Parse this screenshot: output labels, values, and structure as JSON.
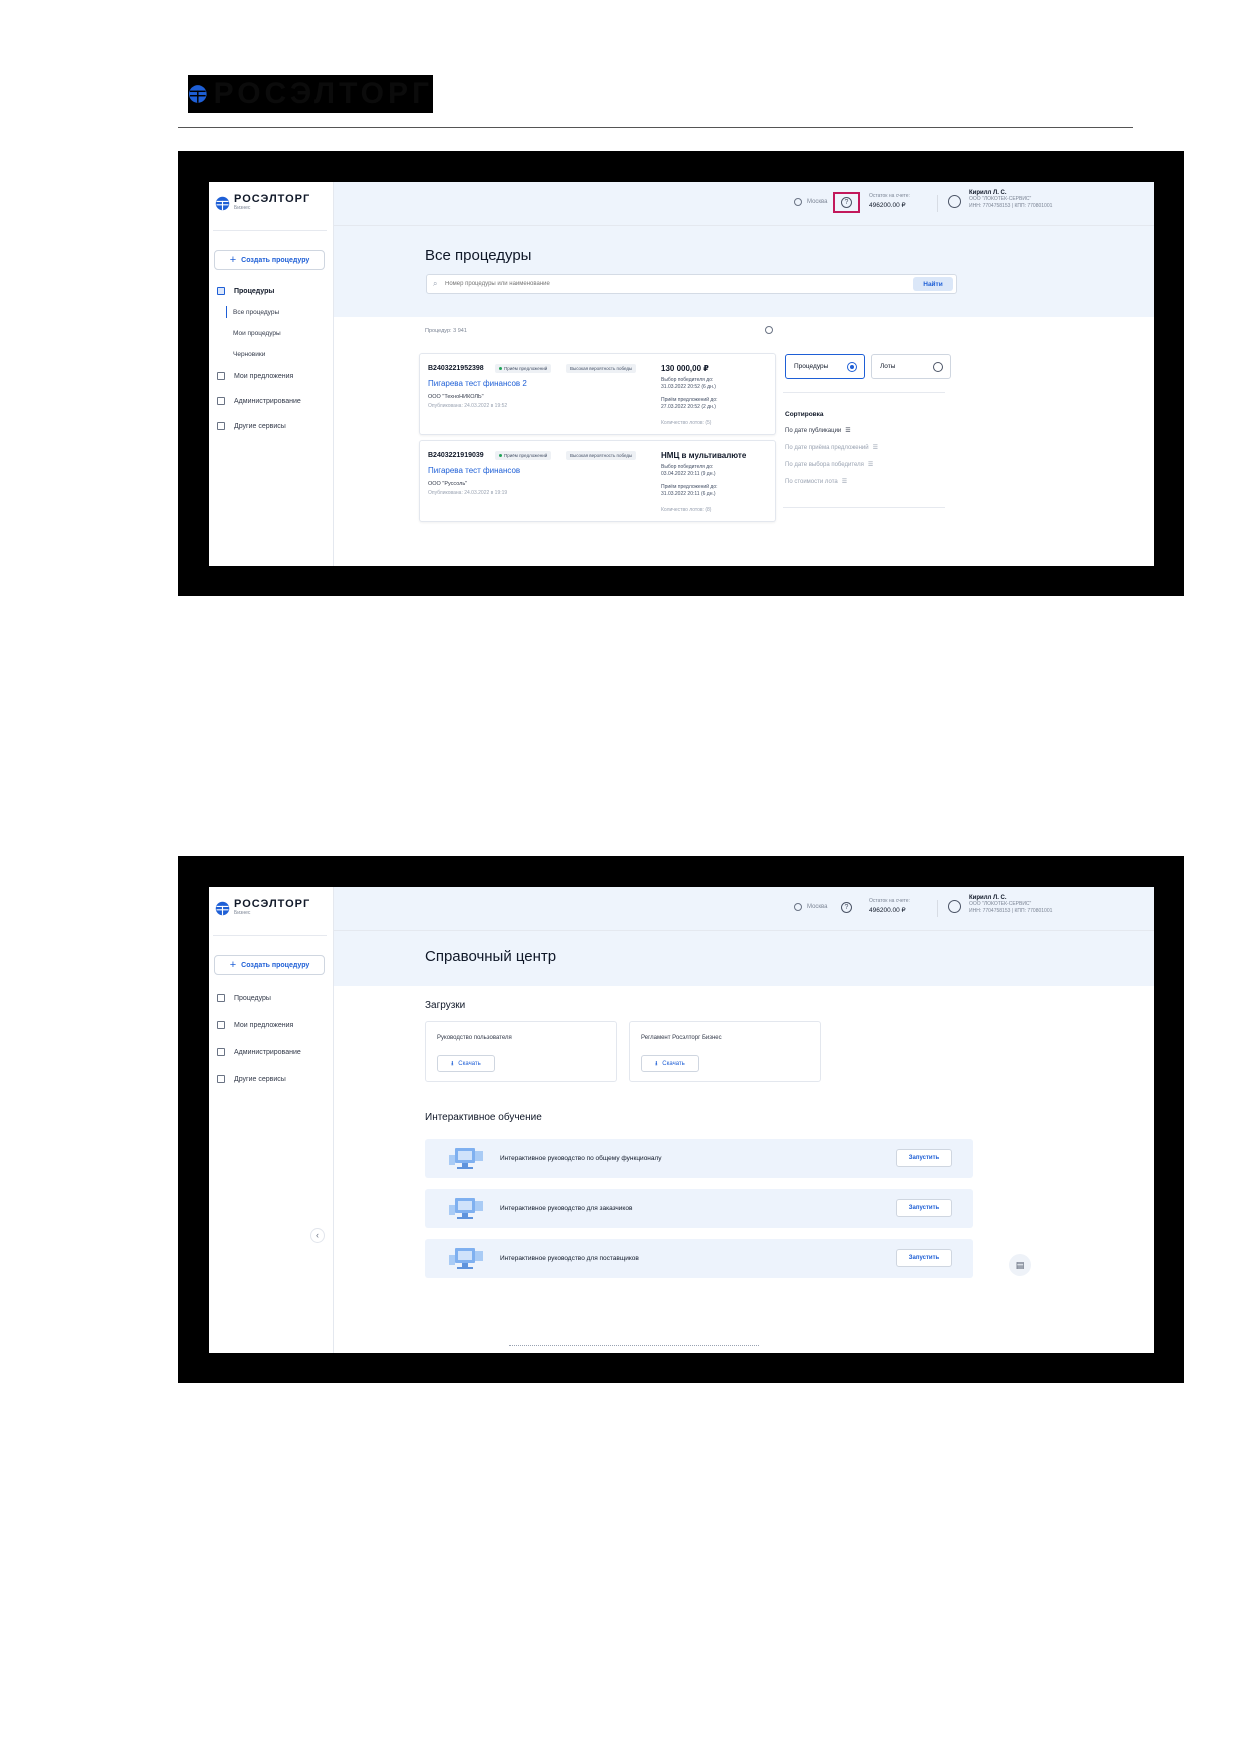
{
  "doc_header": {
    "logo_text": "РОСЭЛТОРГ"
  },
  "app": {
    "brand": "РОСЭЛТОРГ",
    "brand_sub": "Бизнес",
    "create_button": "Создать процедуру",
    "topbar": {
      "location": "Москва",
      "balance_label": "Остаток на счете:",
      "balance_value": "496200.00 ₽",
      "user_name": "Кирилл Л. С.",
      "user_org": "ООО \"ЛОКОТЕК-СЕРВИС\"",
      "user_inn": "ИНН: 7704758153 | КПП: 770801001"
    },
    "nav": {
      "procedures": "Процедуры",
      "all_procedures": "Все процедуры",
      "my_procedures": "Мои процедуры",
      "drafts": "Черновики",
      "my_offers": "Мои предложения",
      "administration": "Администрирование",
      "other_services": "Другие сервисы"
    }
  },
  "screen1": {
    "title": "Все процедуры",
    "search_placeholder": "Номер процедуры или наименование",
    "find_button": "Найти",
    "count_text": "Процедур: 3 941",
    "cards": [
      {
        "number": "B2403221952398",
        "status": "Приём предложений",
        "tag": "Высокая вероятность победы",
        "title": "Пигарева тест финансов 2",
        "org": "ООО \"ТехноНИКОЛЬ\"",
        "published": "Опубликована: 24.03.2022 в 19:52",
        "price": "130 000,00 ₽",
        "winner_label": "Выбор победителя до:",
        "winner_date": "31.03.2022 20:52 (6 дн.)",
        "offers_label": "Приём предложений до:",
        "offers_date": "27.03.2022 20:52 (2 дн.)",
        "lots": "Количество лотов: (5)"
      },
      {
        "number": "B2403221919039",
        "status": "Приём предложений",
        "tag": "Высокая вероятность победы",
        "title": "Пигарева тест финансов",
        "org": "ООО \"Руссоль\"",
        "published": "Опубликована: 24.03.2022 в 19:19",
        "price": "НМЦ в мультивалюте",
        "winner_label": "Выбор победителя до:",
        "winner_date": "03.04.2022 20:11 (9 дн.)",
        "offers_label": "Приём предложений до:",
        "offers_date": "31.03.2022 20:11 (6 дн.)",
        "lots": "Количество лотов: (8)"
      }
    ],
    "toggle_procedures": "Процедуры",
    "toggle_lots": "Лоты",
    "sort_title": "Сортировка",
    "sort_items": [
      "По дате публикации",
      "По дате приёма предложений",
      "По дате выбора победителя",
      "По стоимости лота"
    ]
  },
  "screen2": {
    "title": "Справочный центр",
    "downloads_title": "Загрузки",
    "downloads": [
      {
        "name": "Руководство пользователя",
        "button": "Скачать"
      },
      {
        "name": "Регламент Росэлторг Бизнес",
        "button": "Скачать"
      }
    ],
    "training_title": "Интерактивное обучение",
    "courses": [
      {
        "title": "Интерактивное руководство по общему функционалу",
        "button": "Запустить"
      },
      {
        "title": "Интерактивное руководство для заказчиков",
        "button": "Запустить"
      },
      {
        "title": "Интерактивное руководство для поставщиков",
        "button": "Запустить"
      }
    ]
  }
}
